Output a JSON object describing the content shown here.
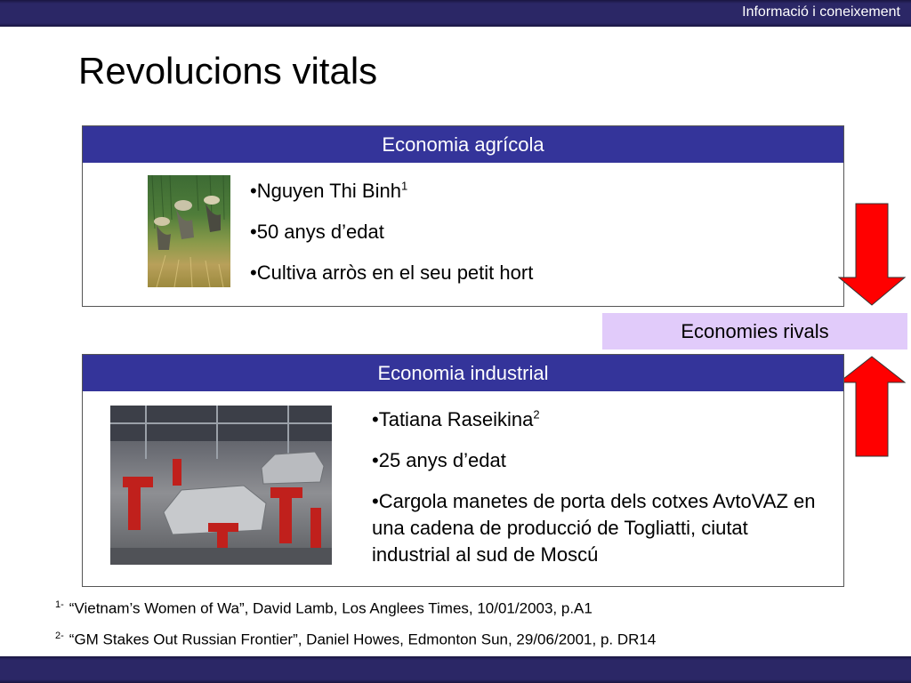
{
  "header": {
    "section": "Informació i coneixement"
  },
  "title": "Revolucions vitals",
  "agricultural": {
    "heading": "Economia agrícola",
    "bullets": [
      {
        "text": "•Nguyen Thi Binh",
        "sup": "1"
      },
      {
        "text": "•50 anys d’edat"
      },
      {
        "text": "•Cultiva arròs en el seu petit hort"
      }
    ]
  },
  "rivals": {
    "label": "Economies rivals"
  },
  "industrial": {
    "heading": "Economia industrial",
    "bullets": [
      {
        "text": "•Tatiana Raseikina",
        "sup": "2"
      },
      {
        "text": "•25 anys d’edat"
      },
      {
        "text": "•Cargola manetes de porta dels cotxes AvtoVAZ en una cadena de producció de Togliatti, ciutat industrial al sud de Moscú"
      }
    ]
  },
  "footnotes": [
    {
      "mark": "1-",
      "text": "“Vietnam’s Women of Wa”, David Lamb, Los Anglees Times, 10/01/2003, p.A1"
    },
    {
      "mark": "2-",
      "text": "“GM Stakes Out Russian Frontier”, Daniel Howes, Edmonton Sun, 29/06/2001, p. DR14"
    }
  ],
  "colors": {
    "band": "#2b2766",
    "panel_header": "#34349a",
    "rivals_bg": "#e1cbfa",
    "arrow": "#ff0000"
  }
}
